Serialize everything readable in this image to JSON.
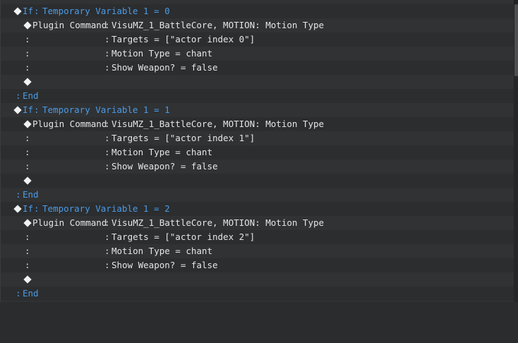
{
  "blocks": [
    {
      "if_keyword": "If",
      "if_condition": "Temporary Variable 1 = 0",
      "command": "Plugin Command",
      "command_value": "VisuMZ_1_BattleCore, MOTION: Motion Type",
      "params": [
        "Targets = [\"actor index 0\"]",
        "Motion Type = chant",
        "Show Weapon? = false"
      ],
      "end": "End"
    },
    {
      "if_keyword": "If",
      "if_condition": "Temporary Variable 1 = 1",
      "command": "Plugin Command",
      "command_value": "VisuMZ_1_BattleCore, MOTION: Motion Type",
      "params": [
        "Targets = [\"actor index 1\"]",
        "Motion Type = chant",
        "Show Weapon? = false"
      ],
      "end": "End"
    },
    {
      "if_keyword": "If",
      "if_condition": "Temporary Variable 1 = 2",
      "command": "Plugin Command",
      "command_value": "VisuMZ_1_BattleCore, MOTION: Motion Type",
      "params": [
        "Targets = [\"actor index 2\"]",
        "Motion Type = chant",
        "Show Weapon? = false"
      ],
      "end": "End"
    }
  ],
  "colors": {
    "keyword_blue": "#4b9be6",
    "text": "#e3e5e7",
    "row_bg": "#303234",
    "row_alt_bg": "#2b2d2f"
  }
}
